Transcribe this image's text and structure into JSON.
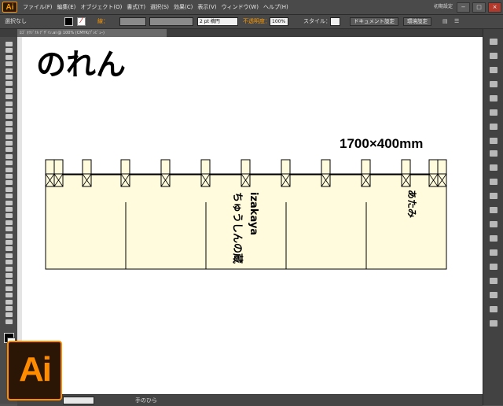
{
  "app": {
    "badge": "Ai",
    "workspace": "初期設定"
  },
  "menu": [
    "ファイル(F)",
    "編集(E)",
    "オブジェクト(O)",
    "書式(T)",
    "選択(S)",
    "効果(C)",
    "表示(V)",
    "ウィンドウ(W)",
    "ヘルプ(H)"
  ],
  "window_controls": {
    "minimize": "−",
    "maximize": "□",
    "close": "×"
  },
  "control_bar": {
    "selection": "選択なし",
    "stroke_label": "線：",
    "stroke_weight": "2 pt 楕円",
    "opacity_label": "不透明度：",
    "opacity_value": "100%",
    "style_label": "スタイル：",
    "doc_settings": "ドキュメント設定",
    "env_settings": "環境設定"
  },
  "tab": {
    "label": "ﾛｺﾞ ｵﾘｼﾞﾅﾙ ﾃﾞｻﾞｲﾝ.ai @ 100% (CMYK/ﾌﾟﾚﾋﾞｭｰ)"
  },
  "canvas": {
    "title": "のれん",
    "dimensions": "1700×400mm",
    "shop_name": "izakaya\nちゅうしんの蔵",
    "tag": "あたみ",
    "bg_color": "#fffbdc"
  },
  "statusbar": {
    "tool": "手のひら"
  },
  "colors": {
    "accent": "#ff9a00"
  }
}
